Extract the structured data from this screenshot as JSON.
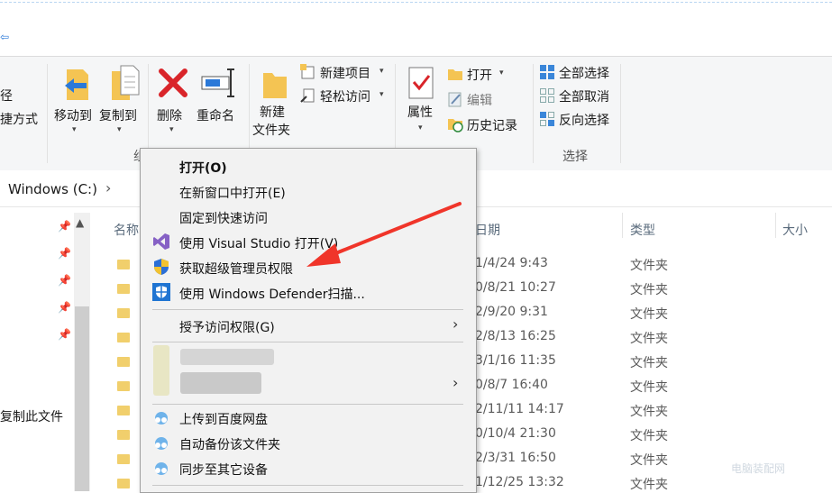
{
  "window": {
    "nav_arrow": "⇦"
  },
  "ribbon": {
    "left_cut": {
      "line1": "径",
      "line2": "捷方式"
    },
    "organize": {
      "move_to": "移动到",
      "copy_to": "复制到",
      "delete": "删除",
      "rename": "重命名",
      "group_label": "组"
    },
    "new": {
      "new_folder_line1": "新建",
      "new_folder_line2": "文件夹",
      "new_item": "新建项目",
      "easy_access": "轻松访问"
    },
    "open": {
      "properties": "属性",
      "open": "打开",
      "edit": "编辑",
      "history": "历史记录"
    },
    "select": {
      "select_all": "全部选择",
      "select_none": "全部取消",
      "invert": "反向选择",
      "group_label": "选择"
    }
  },
  "address": {
    "path": "Windows (C:)",
    "chevron": "›"
  },
  "nav": {
    "copy_label": "复制此文件"
  },
  "columns": {
    "name": "名称",
    "date": "日期",
    "type": "类型",
    "size": "大小"
  },
  "rows": [
    {
      "date": "1/4/24 9:43",
      "type": "文件夹"
    },
    {
      "date": "0/8/21 10:27",
      "type": "文件夹"
    },
    {
      "date": "2/9/20 9:31",
      "type": "文件夹"
    },
    {
      "date": "2/8/13 16:25",
      "type": "文件夹"
    },
    {
      "date": "3/1/16 11:35",
      "type": "文件夹"
    },
    {
      "date": "0/8/7 16:40",
      "type": "文件夹"
    },
    {
      "date": "2/11/11 14:17",
      "type": "文件夹"
    },
    {
      "date": "0/10/4 21:30",
      "type": "文件夹"
    },
    {
      "date": "2/3/31 16:50",
      "type": "文件夹"
    },
    {
      "date": "1/12/25 13:32",
      "type": "文件夹"
    }
  ],
  "context_menu": {
    "open": "打开(O)",
    "open_new_window": "在新窗口中打开(E)",
    "pin_quick_access": "固定到快速访问",
    "open_vs": "使用 Visual Studio 打开(V)",
    "admin": "获取超级管理员权限",
    "defender": "使用 Windows Defender扫描...",
    "grant_access": "授予访问权限(G)",
    "upload_baidu": "上传到百度网盘",
    "auto_backup": "自动备份该文件夹",
    "sync_devices": "同步至其它设备"
  },
  "watermark": "电脑装配网",
  "colors": {
    "annotation_arrow": "#f0352a",
    "folder": "#f1cf6c",
    "accent": "#2b79d8",
    "vs_purple": "#8661c5",
    "defender_blue": "#1f74d2"
  }
}
